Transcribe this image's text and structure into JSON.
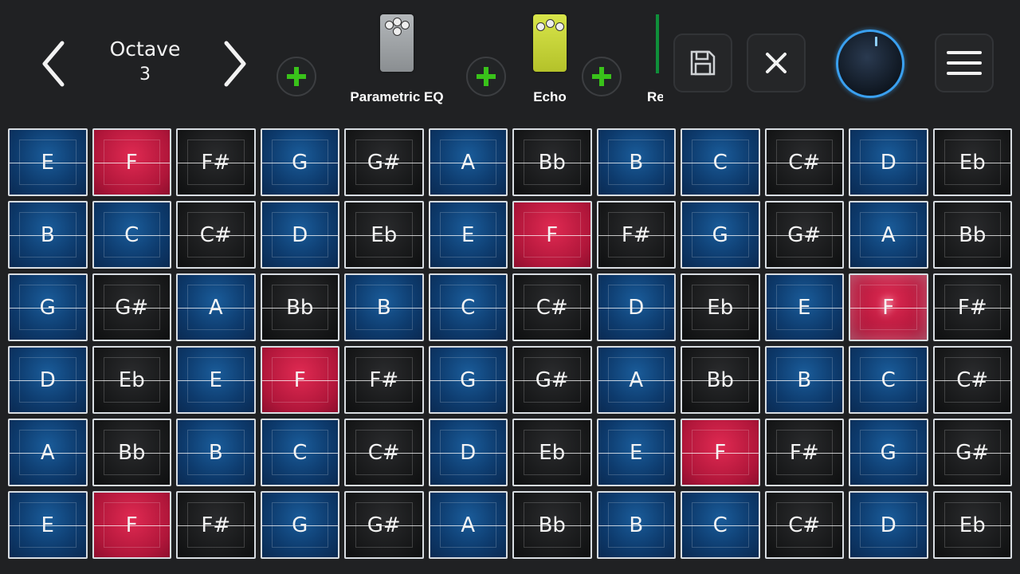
{
  "header": {
    "octave_label": "Octave",
    "octave_value": "3",
    "effects": [
      {
        "name": "Parametric EQ",
        "color": "#9ea2a5"
      },
      {
        "name": "Echo",
        "color": "#c7d43a"
      },
      {
        "name": "Re"
      }
    ],
    "icons": {
      "prev": "chevron-left-icon",
      "next": "chevron-right-icon",
      "add": "plus-icon",
      "save": "floppy-disk-icon",
      "close": "close-icon",
      "menu": "hamburger-menu-icon"
    }
  },
  "colors": {
    "blue": "#0d3a6c",
    "black": "#161718",
    "red": "#b0163a",
    "accent_green": "#39c21a",
    "knob_ring": "#3aa0f0"
  },
  "grid": {
    "rows": [
      [
        {
          "note": "E",
          "color": "blue"
        },
        {
          "note": "F",
          "color": "red"
        },
        {
          "note": "F#",
          "color": "black"
        },
        {
          "note": "G",
          "color": "blue"
        },
        {
          "note": "G#",
          "color": "black"
        },
        {
          "note": "A",
          "color": "blue"
        },
        {
          "note": "Bb",
          "color": "black"
        },
        {
          "note": "B",
          "color": "blue"
        },
        {
          "note": "C",
          "color": "blue"
        },
        {
          "note": "C#",
          "color": "black"
        },
        {
          "note": "D",
          "color": "blue"
        },
        {
          "note": "Eb",
          "color": "black"
        }
      ],
      [
        {
          "note": "B",
          "color": "blue"
        },
        {
          "note": "C",
          "color": "blue"
        },
        {
          "note": "C#",
          "color": "black"
        },
        {
          "note": "D",
          "color": "blue"
        },
        {
          "note": "Eb",
          "color": "black"
        },
        {
          "note": "E",
          "color": "blue"
        },
        {
          "note": "F",
          "color": "red"
        },
        {
          "note": "F#",
          "color": "black"
        },
        {
          "note": "G",
          "color": "blue"
        },
        {
          "note": "G#",
          "color": "black"
        },
        {
          "note": "A",
          "color": "blue"
        },
        {
          "note": "Bb",
          "color": "black"
        }
      ],
      [
        {
          "note": "G",
          "color": "blue"
        },
        {
          "note": "G#",
          "color": "black"
        },
        {
          "note": "A",
          "color": "blue"
        },
        {
          "note": "Bb",
          "color": "black"
        },
        {
          "note": "B",
          "color": "blue"
        },
        {
          "note": "C",
          "color": "blue"
        },
        {
          "note": "C#",
          "color": "black"
        },
        {
          "note": "D",
          "color": "blue"
        },
        {
          "note": "Eb",
          "color": "black"
        },
        {
          "note": "E",
          "color": "blue"
        },
        {
          "note": "F",
          "color": "red",
          "active": true
        },
        {
          "note": "F#",
          "color": "black"
        }
      ],
      [
        {
          "note": "D",
          "color": "blue"
        },
        {
          "note": "Eb",
          "color": "black"
        },
        {
          "note": "E",
          "color": "blue"
        },
        {
          "note": "F",
          "color": "red"
        },
        {
          "note": "F#",
          "color": "black"
        },
        {
          "note": "G",
          "color": "blue"
        },
        {
          "note": "G#",
          "color": "black"
        },
        {
          "note": "A",
          "color": "blue"
        },
        {
          "note": "Bb",
          "color": "black"
        },
        {
          "note": "B",
          "color": "blue"
        },
        {
          "note": "C",
          "color": "blue"
        },
        {
          "note": "C#",
          "color": "black"
        }
      ],
      [
        {
          "note": "A",
          "color": "blue"
        },
        {
          "note": "Bb",
          "color": "black"
        },
        {
          "note": "B",
          "color": "blue"
        },
        {
          "note": "C",
          "color": "blue"
        },
        {
          "note": "C#",
          "color": "black"
        },
        {
          "note": "D",
          "color": "blue"
        },
        {
          "note": "Eb",
          "color": "black"
        },
        {
          "note": "E",
          "color": "blue"
        },
        {
          "note": "F",
          "color": "red"
        },
        {
          "note": "F#",
          "color": "black"
        },
        {
          "note": "G",
          "color": "blue"
        },
        {
          "note": "G#",
          "color": "black"
        }
      ],
      [
        {
          "note": "E",
          "color": "blue"
        },
        {
          "note": "F",
          "color": "red"
        },
        {
          "note": "F#",
          "color": "black"
        },
        {
          "note": "G",
          "color": "blue"
        },
        {
          "note": "G#",
          "color": "black"
        },
        {
          "note": "A",
          "color": "blue"
        },
        {
          "note": "Bb",
          "color": "black"
        },
        {
          "note": "B",
          "color": "blue"
        },
        {
          "note": "C",
          "color": "blue"
        },
        {
          "note": "C#",
          "color": "black"
        },
        {
          "note": "D",
          "color": "blue"
        },
        {
          "note": "Eb",
          "color": "black"
        }
      ]
    ]
  }
}
